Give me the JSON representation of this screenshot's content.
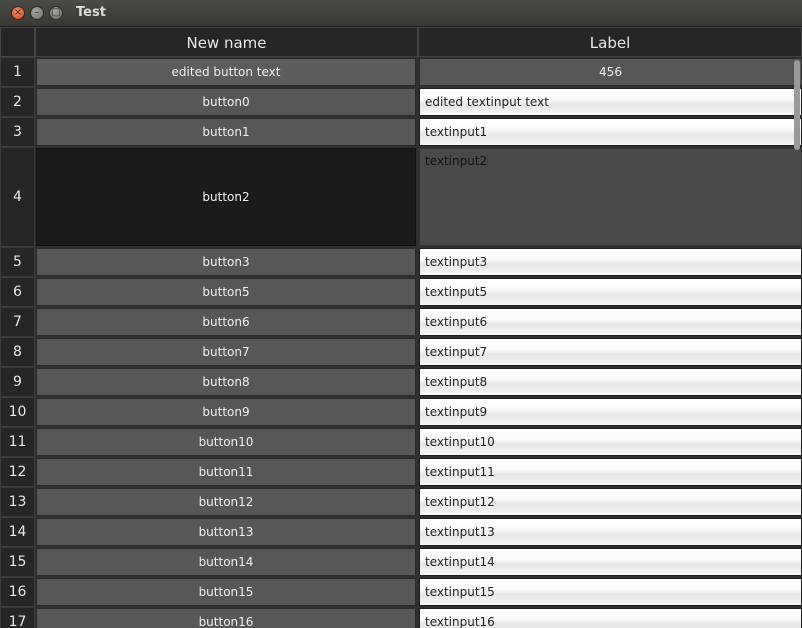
{
  "window": {
    "title": "Test"
  },
  "table": {
    "columns": [
      "New name",
      "Label"
    ],
    "rows": [
      {
        "num": "1",
        "button": "edited button text",
        "input": "456"
      },
      {
        "num": "2",
        "button": "button0",
        "input": "edited textinput text"
      },
      {
        "num": "3",
        "button": "button1",
        "input": "textinput1"
      },
      {
        "num": "4",
        "button": "button2",
        "input": "textinput2"
      },
      {
        "num": "5",
        "button": "button3",
        "input": "textinput3"
      },
      {
        "num": "6",
        "button": "button5",
        "input": "textinput5"
      },
      {
        "num": "7",
        "button": "button6",
        "input": "textinput6"
      },
      {
        "num": "8",
        "button": "button7",
        "input": "textinput7"
      },
      {
        "num": "9",
        "button": "button8",
        "input": "textinput8"
      },
      {
        "num": "10",
        "button": "button9",
        "input": "textinput9"
      },
      {
        "num": "11",
        "button": "button10",
        "input": "textinput10"
      },
      {
        "num": "12",
        "button": "button11",
        "input": "textinput11"
      },
      {
        "num": "13",
        "button": "button12",
        "input": "textinput12"
      },
      {
        "num": "14",
        "button": "button13",
        "input": "textinput13"
      },
      {
        "num": "15",
        "button": "button14",
        "input": "textinput14"
      },
      {
        "num": "16",
        "button": "button15",
        "input": "textinput15"
      },
      {
        "num": "17",
        "button": "button16",
        "input": "textinput16"
      }
    ]
  }
}
